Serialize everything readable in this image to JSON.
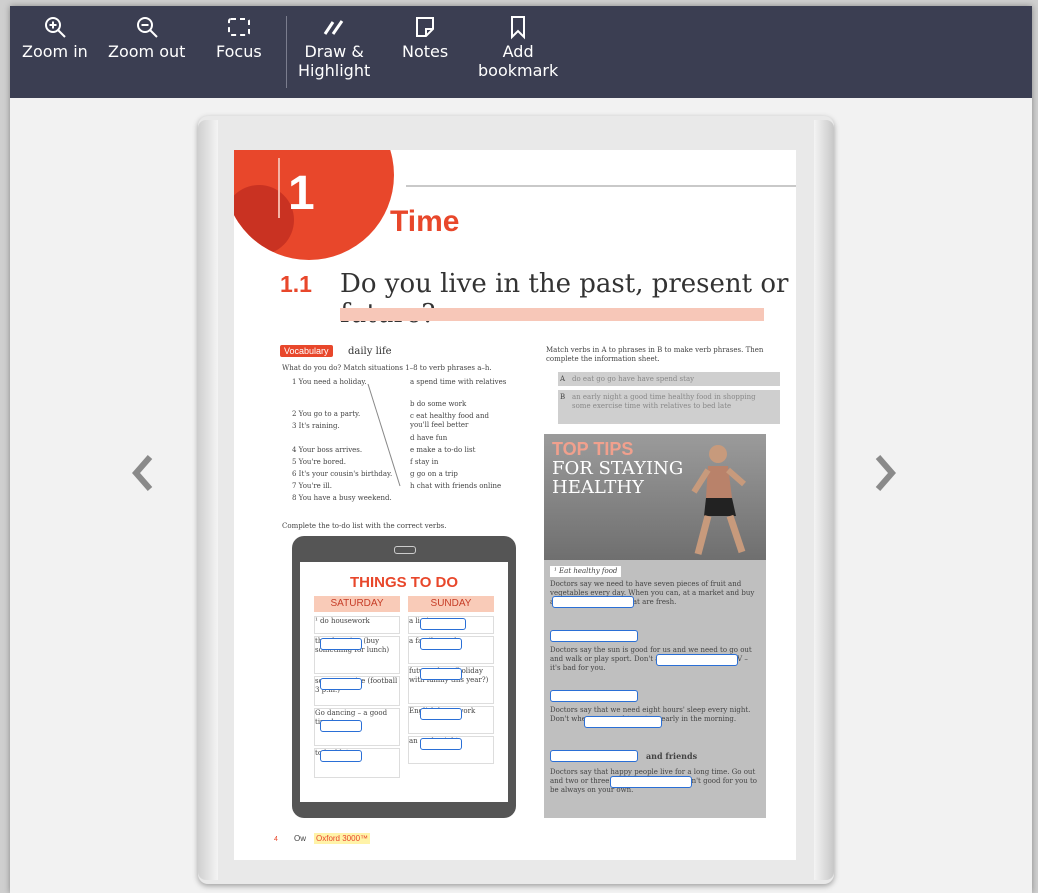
{
  "toolbar": {
    "zoom_in": "Zoom in",
    "zoom_out": "Zoom out",
    "focus": "Focus",
    "draw_line1": "Draw &",
    "draw_line2": "Highlight",
    "notes": "Notes",
    "bookmark_line1": "Add",
    "bookmark_line2": "bookmark"
  },
  "page": {
    "unit_number": "1",
    "unit_title": "Time",
    "lesson_number": "1.1",
    "lesson_title": "Do you live in the past, present or future?",
    "vocab_badge": "Vocabulary",
    "vocab_sub": "daily life",
    "ex1_instruction": "What do you do? Match situations 1–8 to verb phrases a–h.",
    "ex1_items": [
      "1  You need a holiday.",
      "2  You go to a party.",
      "3  It's raining.",
      "4  Your boss arrives.",
      "5  You're bored.",
      "6  It's your cousin's birthday.",
      "7  You're ill.",
      "8  You have a busy weekend."
    ],
    "ex1_answers": [
      "a  spend time with relatives",
      "b  do some work",
      "c  eat healthy food and you'll feel better",
      "d  have fun",
      "e  make a to-do list",
      "f  stay in",
      "g  go on a trip",
      "h  chat with friends online"
    ],
    "ex2_instruction": "Complete the to-do list with the correct verbs.",
    "ex3_instruction": "Match verbs in A to phrases in B to make verb phrases. Then complete the information sheet.",
    "matchA_label": "A",
    "matchA_text": "do  eat  go  go  have  have  spend  stay",
    "matchB_label": "B",
    "matchB_text": "an early night  a good time  healthy food  in  shopping  some exercise  time with relatives  to bed late",
    "ttd_title": "THINGS TO DO",
    "saturday": "SATURDAY",
    "sunday": "SUNDAY",
    "sat_cells": [
      "¹ do  housework",
      "the shopping (buy something for lunch)",
      "some exercise (football 3 p.m.)",
      "Go dancing – a good time!",
      "to bed late"
    ],
    "sun_cells": [
      "a lie-in",
      "a family meal",
      "future plans (holiday with family this year?)",
      "English homework",
      "an early night"
    ],
    "tips_title1": "TOP TIPS",
    "tips_title2": "FOR STAYING HEALTHY",
    "tip1_head": "¹ Eat healthy food",
    "tip1_text": "Doctors say we need to have seven pieces of fruit and vegetables every day. When you can, at a market and buy apples and tomatoes that are fresh.",
    "tip2_text": "Doctors say the sun is good for us and we need to go out and walk or play sport. Don't all day in front of the TV – it's bad for you.",
    "tip3_text": "Doctors say that we need eight hours' sleep every night. Don't when you need to get up early in the morning.",
    "tip4_head": "and friends",
    "tip4_text": "Doctors say that happy people live for a long time. Go out and two or three times every week. It isn't good for you to be always on your own.",
    "footer_num": "4",
    "footer_text": "Ow",
    "footer_brand": "Oxford 3000™"
  },
  "icons": [
    "zoom-in-icon",
    "zoom-out-icon",
    "focus-icon",
    "draw-highlight-icon",
    "notes-icon",
    "bookmark-icon",
    "chevron-left-icon",
    "chevron-right-icon"
  ],
  "colors": {
    "toolbar": "#3b3e52",
    "accent": "#e8472b",
    "highlight_box": "#2a6fd6"
  }
}
